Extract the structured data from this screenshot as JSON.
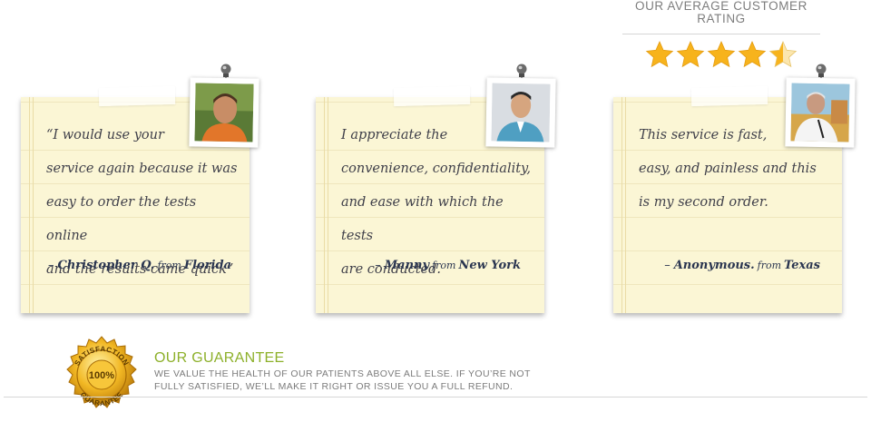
{
  "rating": {
    "title": "OUR AVERAGE CUSTOMER RATING",
    "value": 4.5,
    "max": 5,
    "star_color": "#f7b31c"
  },
  "testimonials": [
    {
      "text_lines": [
        "“I would use your",
        "service again because it was",
        "easy to order the tests online",
        "and the results came quick”"
      ],
      "name": "Christopher Q.",
      "from": "from",
      "place": "Florida",
      "photo_icon": "man-orange-shirt-photo"
    },
    {
      "text_lines": [
        "I appreciate the",
        "convenience, confidentiality,",
        "and ease with which the tests",
        "are conducted."
      ],
      "name": "Manny",
      "from": "from",
      "place": "New York",
      "photo_icon": "man-blue-sweater-photo"
    },
    {
      "text_lines": [
        "This service is fast,",
        "easy, and painless and this",
        "is my second order."
      ],
      "name": "Anonymous.",
      "from": "from",
      "place": "Texas",
      "photo_icon": "man-outdoor-photo"
    }
  ],
  "guarantee": {
    "title": "OUR GUARANTEE",
    "text": "WE VALUE THE HEALTH OF OUR PATIENTS ABOVE ALL ELSE. IF YOU’RE NOT FULLY SATISFIED, WE’LL MAKE IT RIGHT OR ISSUE YOU A FULL REFUND.",
    "seal_top": "SATISFACTION",
    "seal_center": "100%",
    "seal_bottom": "GUARANTEE",
    "accent_color": "#8db02a"
  }
}
